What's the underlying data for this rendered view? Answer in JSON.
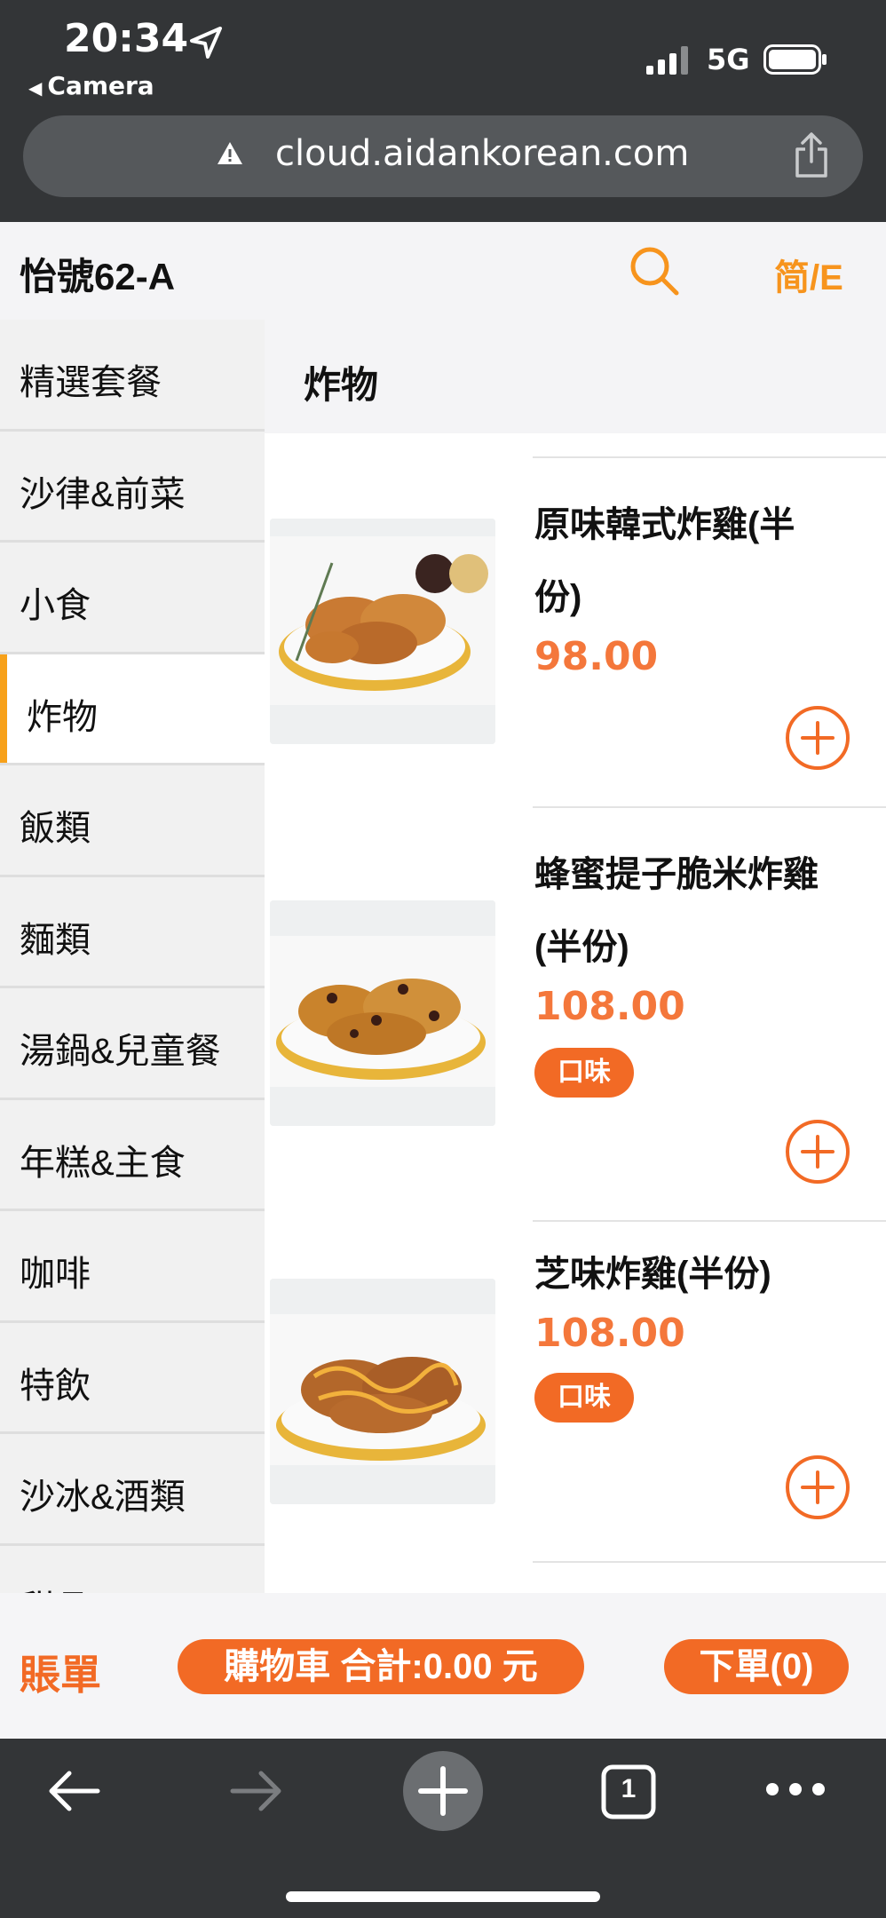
{
  "status_bar": {
    "time": "20:34",
    "back_app": "Camera",
    "network": "5G"
  },
  "browser": {
    "url": "cloud.aidankorean.com"
  },
  "header": {
    "store_name": "怡號62-A",
    "language_toggle": "简/E"
  },
  "sidebar": {
    "items": [
      {
        "label": "精選套餐"
      },
      {
        "label": "沙律&前菜"
      },
      {
        "label": "小食"
      },
      {
        "label": "炸物",
        "active": true
      },
      {
        "label": "飯類"
      },
      {
        "label": "麵類"
      },
      {
        "label": "湯鍋&兒童餐"
      },
      {
        "label": "年糕&主食"
      },
      {
        "label": "咖啡"
      },
      {
        "label": "特飲"
      },
      {
        "label": "沙冰&酒類"
      },
      {
        "label": "甜品"
      }
    ]
  },
  "main": {
    "section_title": "炸物",
    "items": [
      {
        "name_line1": "原味韓式炸雞(半",
        "name_line2": "份)",
        "price": "98.00"
      },
      {
        "name_line1": "蜂蜜提子脆米炸雞",
        "name_line2": "(半份)",
        "price": "108.00",
        "flavor": "口味"
      },
      {
        "name_line1": "芝味炸雞(半份)",
        "price": "108.00",
        "flavor": "口味"
      }
    ]
  },
  "order_bar": {
    "bill": "賬單",
    "cart": "購物車 合計:0.00 元",
    "submit": "下單(0)"
  },
  "toolbar": {
    "tab_count": "1"
  },
  "colors": {
    "accent": "#f26a25",
    "price": "#f4773b",
    "header_icons": "#f7941d",
    "active_indicator": "#f7a11a",
    "chrome": "#333537"
  }
}
